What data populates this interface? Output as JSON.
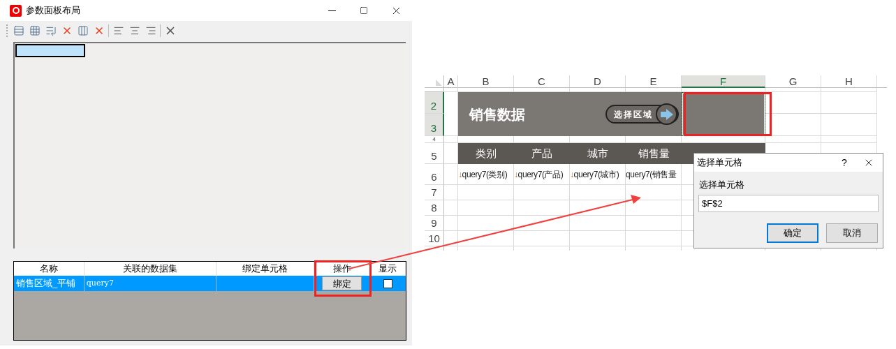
{
  "panel_window": {
    "title": "参数面板布局",
    "layout_grid": {
      "cell_selected": true
    },
    "table": {
      "columns": [
        "名称",
        "关联的数据集",
        "绑定单元格",
        "操作",
        "显示"
      ],
      "rows": [
        {
          "name": "销售区域_平铺",
          "dataset": "query7",
          "action": "绑定",
          "show": false,
          "selected": true
        }
      ]
    }
  },
  "sheet": {
    "columns": [
      {
        "label": "A",
        "selected": false
      },
      {
        "label": "B",
        "selected": false
      },
      {
        "label": "C",
        "selected": false
      },
      {
        "label": "D",
        "selected": false
      },
      {
        "label": "E",
        "selected": false
      },
      {
        "label": "F",
        "selected": true
      },
      {
        "label": "G",
        "selected": false
      },
      {
        "label": "H",
        "selected": false
      }
    ],
    "rows": [
      {
        "label": "2",
        "selected": true
      },
      {
        "label": "3",
        "selected": true
      },
      {
        "label": "4",
        "selected": false
      },
      {
        "label": "5",
        "selected": false
      },
      {
        "label": "6",
        "selected": false
      },
      {
        "label": "7",
        "selected": false
      },
      {
        "label": "8",
        "selected": false
      },
      {
        "label": "9",
        "selected": false
      },
      {
        "label": "10",
        "selected": false
      }
    ],
    "banner": {
      "title": "销售数据",
      "button": "选择区域"
    },
    "header_cells": [
      "类别",
      "产品",
      "城市",
      "销售量"
    ],
    "data_cells": [
      {
        "marker": "↓",
        "text": "query7(类别)"
      },
      {
        "marker": "↓",
        "text": "query7(产品)"
      },
      {
        "marker": "↓",
        "text": "query7(城市)"
      },
      {
        "text": "query7(销售量"
      }
    ]
  },
  "dialog": {
    "title": "选择单元格",
    "help": "?",
    "label": "选择单元格",
    "value": "$F$2",
    "buttons": [
      {
        "label": "确定",
        "selected": true
      },
      {
        "label": "取消",
        "selected": false
      }
    ]
  }
}
